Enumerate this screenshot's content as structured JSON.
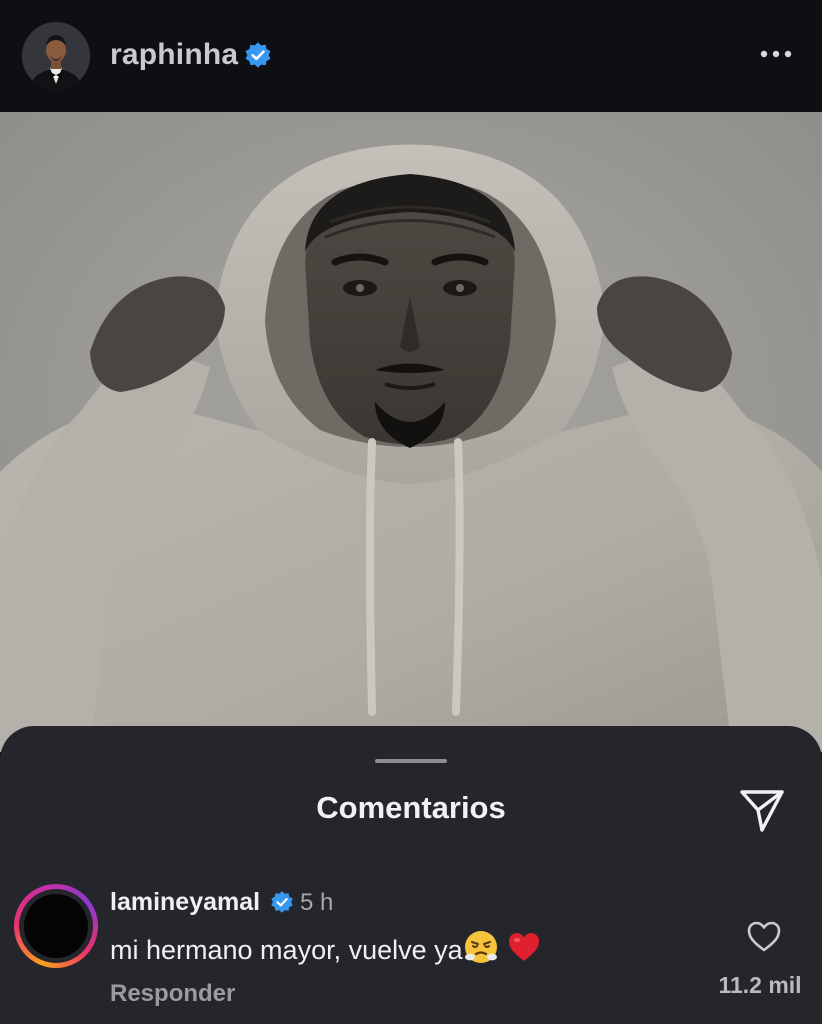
{
  "post_header": {
    "username": "raphinha",
    "verified": true,
    "avatar_icon": "profile-avatar",
    "more_icon": "more-options-icon"
  },
  "post_image": {
    "description_icon": "post-photo"
  },
  "comments_sheet": {
    "title": "Comentarios",
    "share_icon": "paper-plane-icon",
    "comments": [
      {
        "username": "lamineyamal",
        "verified": true,
        "time": "5 h",
        "text": "mi hermano mayor, vuelve ya",
        "emojis": [
          "huffing-face-emoji",
          "red-heart-emoji"
        ],
        "reply_label": "Responder",
        "like_icon": "heart-outline-icon",
        "like_count": "11.2 mil",
        "story_ring": true
      }
    ]
  },
  "colors": {
    "header_bg": "#0e0f13",
    "sheet_bg": "#25262c",
    "verified_blue": "#3897f0",
    "text_primary": "#f0f0f2",
    "text_secondary": "#a6a7ab"
  }
}
